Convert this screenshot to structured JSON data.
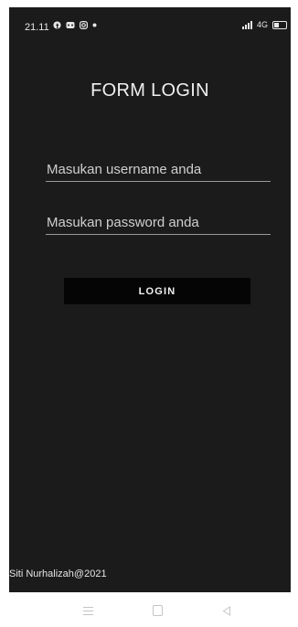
{
  "status_bar": {
    "time": "21.11",
    "network_label": "4G",
    "icons_left": [
      "facebook-icon",
      "game-icon",
      "instagram-icon",
      "dot-icon"
    ],
    "icons_right": [
      "signal-icon",
      "network-icon",
      "battery-icon"
    ]
  },
  "form": {
    "title": "FORM LOGIN",
    "username_placeholder": "Masukan username anda",
    "password_placeholder": "Masukan password anda",
    "login_label": "LOGIN"
  },
  "footer": {
    "credit": "Siti Nurhalizah@2021"
  },
  "nav": {
    "items": [
      "menu-icon",
      "home-icon",
      "back-icon"
    ]
  },
  "colors": {
    "background": "#1c1b1b",
    "button": "#050505",
    "text": "#f0f0f0"
  }
}
